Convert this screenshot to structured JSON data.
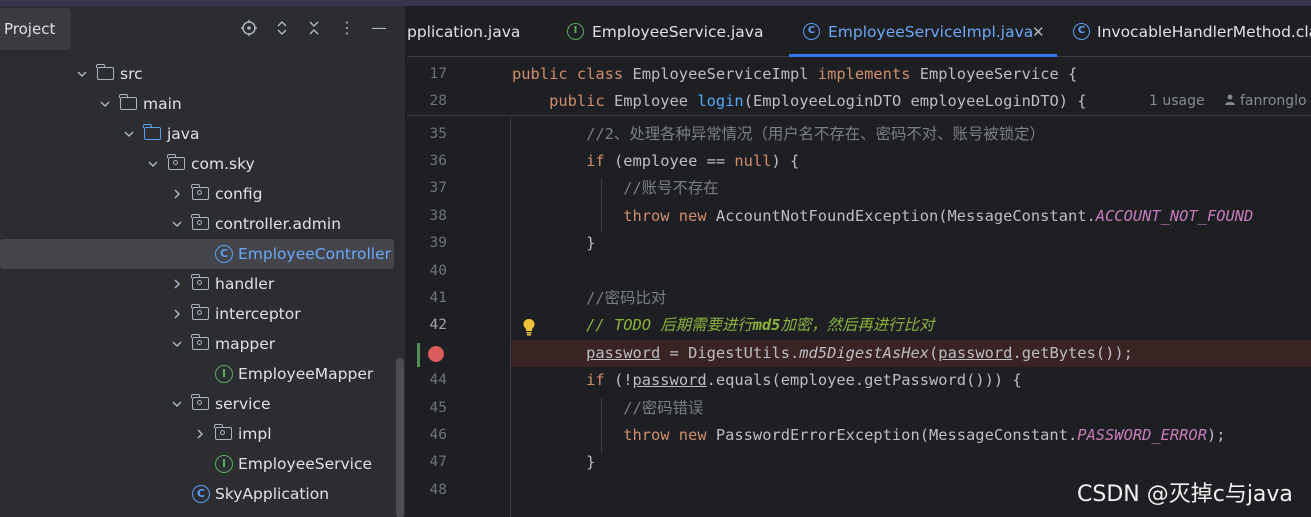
{
  "project": {
    "tab_label": "Project",
    "tree": [
      {
        "label": "src"
      },
      {
        "label": "main"
      },
      {
        "label": "java"
      },
      {
        "label": "com.sky"
      },
      {
        "label": "config"
      },
      {
        "label": "controller.admin"
      },
      {
        "label": "EmployeeController",
        "icon": "C"
      },
      {
        "label": "handler"
      },
      {
        "label": "interceptor"
      },
      {
        "label": "mapper"
      },
      {
        "label": "EmployeeMapper",
        "icon": "I"
      },
      {
        "label": "service"
      },
      {
        "label": "impl"
      },
      {
        "label": "EmployeeService",
        "icon": "I"
      },
      {
        "label": "SkyApplication",
        "icon": "C"
      }
    ]
  },
  "tabs": [
    {
      "label": "pplication.java"
    },
    {
      "label": "EmployeeService.java",
      "icon": "I"
    },
    {
      "label": "EmployeeServiceImpl.java",
      "icon": "C",
      "active": true
    },
    {
      "label": "InvocableHandlerMethod.clas",
      "icon": "C"
    }
  ],
  "editor": {
    "sticky_lines": [
      {
        "num": "17",
        "tokens": [
          {
            "t": "public class ",
            "c": "k"
          },
          {
            "t": "EmployeeServiceImpl ",
            "c": ""
          },
          {
            "t": "implements ",
            "c": "k"
          },
          {
            "t": "EmployeeService {",
            "c": ""
          }
        ]
      },
      {
        "num": "28",
        "tokens": [
          {
            "t": "    public ",
            "c": "k"
          },
          {
            "t": "Employee ",
            "c": ""
          },
          {
            "t": "login",
            "c": "m"
          },
          {
            "t": "(EmployeeLoginDTO employeeLoginDTO) {",
            "c": ""
          }
        ]
      }
    ],
    "usage_hint": "1 usage",
    "author_hint": "fanronglo",
    "lines": [
      {
        "num": "35",
        "tokens": [
          {
            "t": "        //2、处理各种异常情况（用户名不存在、密码不对、账号被锁定）",
            "c": "cm"
          }
        ]
      },
      {
        "num": "36",
        "tokens": [
          {
            "t": "        if ",
            "c": "k"
          },
          {
            "t": "(employee == ",
            "c": ""
          },
          {
            "t": "null",
            "c": "k"
          },
          {
            "t": ") {",
            "c": ""
          }
        ]
      },
      {
        "num": "37",
        "tokens": [
          {
            "t": "            //账号不存在",
            "c": "cm"
          }
        ]
      },
      {
        "num": "38",
        "tokens": [
          {
            "t": "            throw new ",
            "c": "k"
          },
          {
            "t": "AccountNotFoundException(MessageConstant.",
            "c": ""
          },
          {
            "t": "ACCOUNT_NOT_FOUND",
            "c": "it"
          }
        ]
      },
      {
        "num": "39",
        "tokens": [
          {
            "t": "        }",
            "c": ""
          }
        ]
      },
      {
        "num": "40",
        "tokens": []
      },
      {
        "num": "41",
        "tokens": [
          {
            "t": "        //密码比对",
            "c": "cm"
          }
        ]
      },
      {
        "num": "42",
        "tokens": [
          {
            "t": "        // ",
            "c": "todo"
          },
          {
            "t": "TODO 后期需要进行",
            "c": "todo"
          },
          {
            "t": "md5",
            "c": "todob"
          },
          {
            "t": "加密，然后再进行比对",
            "c": "todo"
          }
        ]
      },
      {
        "num": "",
        "tokens": [
          {
            "t": "        ",
            "c": ""
          },
          {
            "t": "password",
            "c": "und"
          },
          {
            "t": " = DigestUtils.",
            "c": ""
          },
          {
            "t": "md5DigestAsHex",
            "c": "ital"
          },
          {
            "t": "(",
            "c": ""
          },
          {
            "t": "password",
            "c": "und"
          },
          {
            "t": ".getBytes());",
            "c": ""
          }
        ]
      },
      {
        "num": "44",
        "tokens": [
          {
            "t": "        if ",
            "c": "k"
          },
          {
            "t": "(!",
            "c": ""
          },
          {
            "t": "password",
            "c": "und"
          },
          {
            "t": ".equals(employee.getPassword())) {",
            "c": ""
          }
        ]
      },
      {
        "num": "45",
        "tokens": [
          {
            "t": "            //密码错误",
            "c": "cm"
          }
        ]
      },
      {
        "num": "46",
        "tokens": [
          {
            "t": "            throw new ",
            "c": "k"
          },
          {
            "t": "PasswordErrorException(MessageConstant.",
            "c": ""
          },
          {
            "t": "PASSWORD_ERROR",
            "c": "it"
          },
          {
            "t": ");",
            "c": ""
          }
        ]
      },
      {
        "num": "47",
        "tokens": [
          {
            "t": "        }",
            "c": ""
          }
        ]
      },
      {
        "num": "48",
        "tokens": []
      }
    ]
  },
  "watermark": "CSDN @灭掉c与java"
}
